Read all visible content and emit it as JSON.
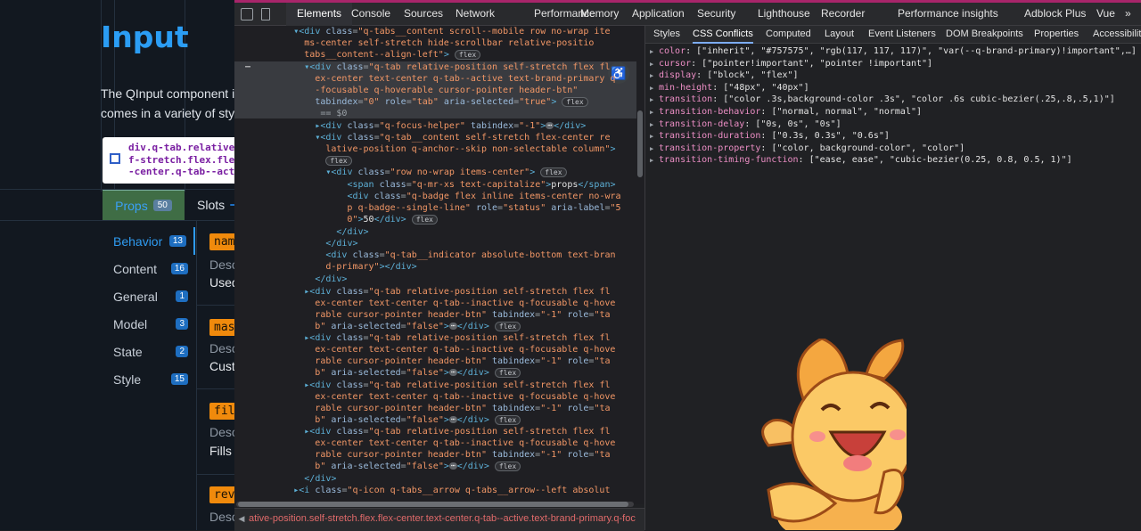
{
  "page": {
    "title": "Input",
    "desc_line1": "The QInput component is",
    "desc_line2": "comes in a variety of sty",
    "tooltip_line1": "div.q-tab.relative-posit",
    "tooltip_line2": "f-stretch.flex.flex-cent",
    "tooltip_line3": "-center.q-tab--activ…",
    "tab_props": "Props",
    "tab_props_badge": "50",
    "tab_slots": "Slots",
    "sidebar": [
      {
        "label": "Behavior",
        "count": "13"
      },
      {
        "label": "Content",
        "count": "16"
      },
      {
        "label": "General",
        "count": "1"
      },
      {
        "label": "Model",
        "count": "3"
      },
      {
        "label": "State",
        "count": "2"
      },
      {
        "label": "Style",
        "count": "15"
      }
    ],
    "cards": [
      {
        "chip": "nam",
        "line1": "Desc",
        "line2": "Used"
      },
      {
        "chip": "mas",
        "line1": "Desc",
        "line2": "Cust"
      },
      {
        "chip": "fill-",
        "line1": "Desc",
        "line2": "Fills"
      },
      {
        "chip": "reve",
        "line1": "Desc",
        "line2": ""
      }
    ]
  },
  "devtools": {
    "main_tabs": [
      "Elements",
      "Console",
      "Sources",
      "Network",
      "Performance",
      "Memory",
      "Application",
      "Security",
      "Lighthouse",
      "Recorder",
      "Performance insights",
      "Adblock Plus",
      "Vue",
      "»"
    ],
    "active_tab": "Elements",
    "side_tabs": [
      "Styles",
      "CSS Conflicts",
      "Computed",
      "Layout",
      "Event Listeners",
      "DOM Breakpoints",
      "Properties",
      "Accessibility"
    ],
    "active_side_tab": "CSS Conflicts",
    "breadcrumb": "ative-position.self-stretch.flex.flex-center.text-center.q-tab--active.text-brand-primary.q-foc",
    "dom_selected_marker": "== $0",
    "flex_label": "flex",
    "dots_label": "⋯",
    "css_conflicts": [
      {
        "name": "color",
        "value": "[\"inherit\", \"#757575\", \"rgb(117, 117, 117)\", \"var(--q-brand-primary)!important\",…]"
      },
      {
        "name": "cursor",
        "value": "[\"pointer!important\", \"pointer !important\"]"
      },
      {
        "name": "display",
        "value": "[\"block\", \"flex\"]"
      },
      {
        "name": "min-height",
        "value": "[\"48px\", \"40px\"]"
      },
      {
        "name": "transition",
        "value": "[\"color .3s,background-color .3s\", \"color .6s cubic-bezier(.25,.8,.5,1)\"]"
      },
      {
        "name": "transition-behavior",
        "value": "[\"normal, normal\", \"normal\"]"
      },
      {
        "name": "transition-delay",
        "value": "[\"0s, 0s\", \"0s\"]"
      },
      {
        "name": "transition-duration",
        "value": "[\"0.3s, 0.3s\", \"0.6s\"]"
      },
      {
        "name": "transition-property",
        "value": "[\"color, background-color\", \"color\"]"
      },
      {
        "name": "transition-timing-function",
        "value": "[\"ease, ease\", \"cubic-bezier(0.25, 0.8, 0.5, 1)\"]"
      }
    ]
  },
  "colors": {
    "brand": "#2b9df4",
    "chip": "#f08a0c",
    "devtools_accent": "#7cacf8"
  }
}
